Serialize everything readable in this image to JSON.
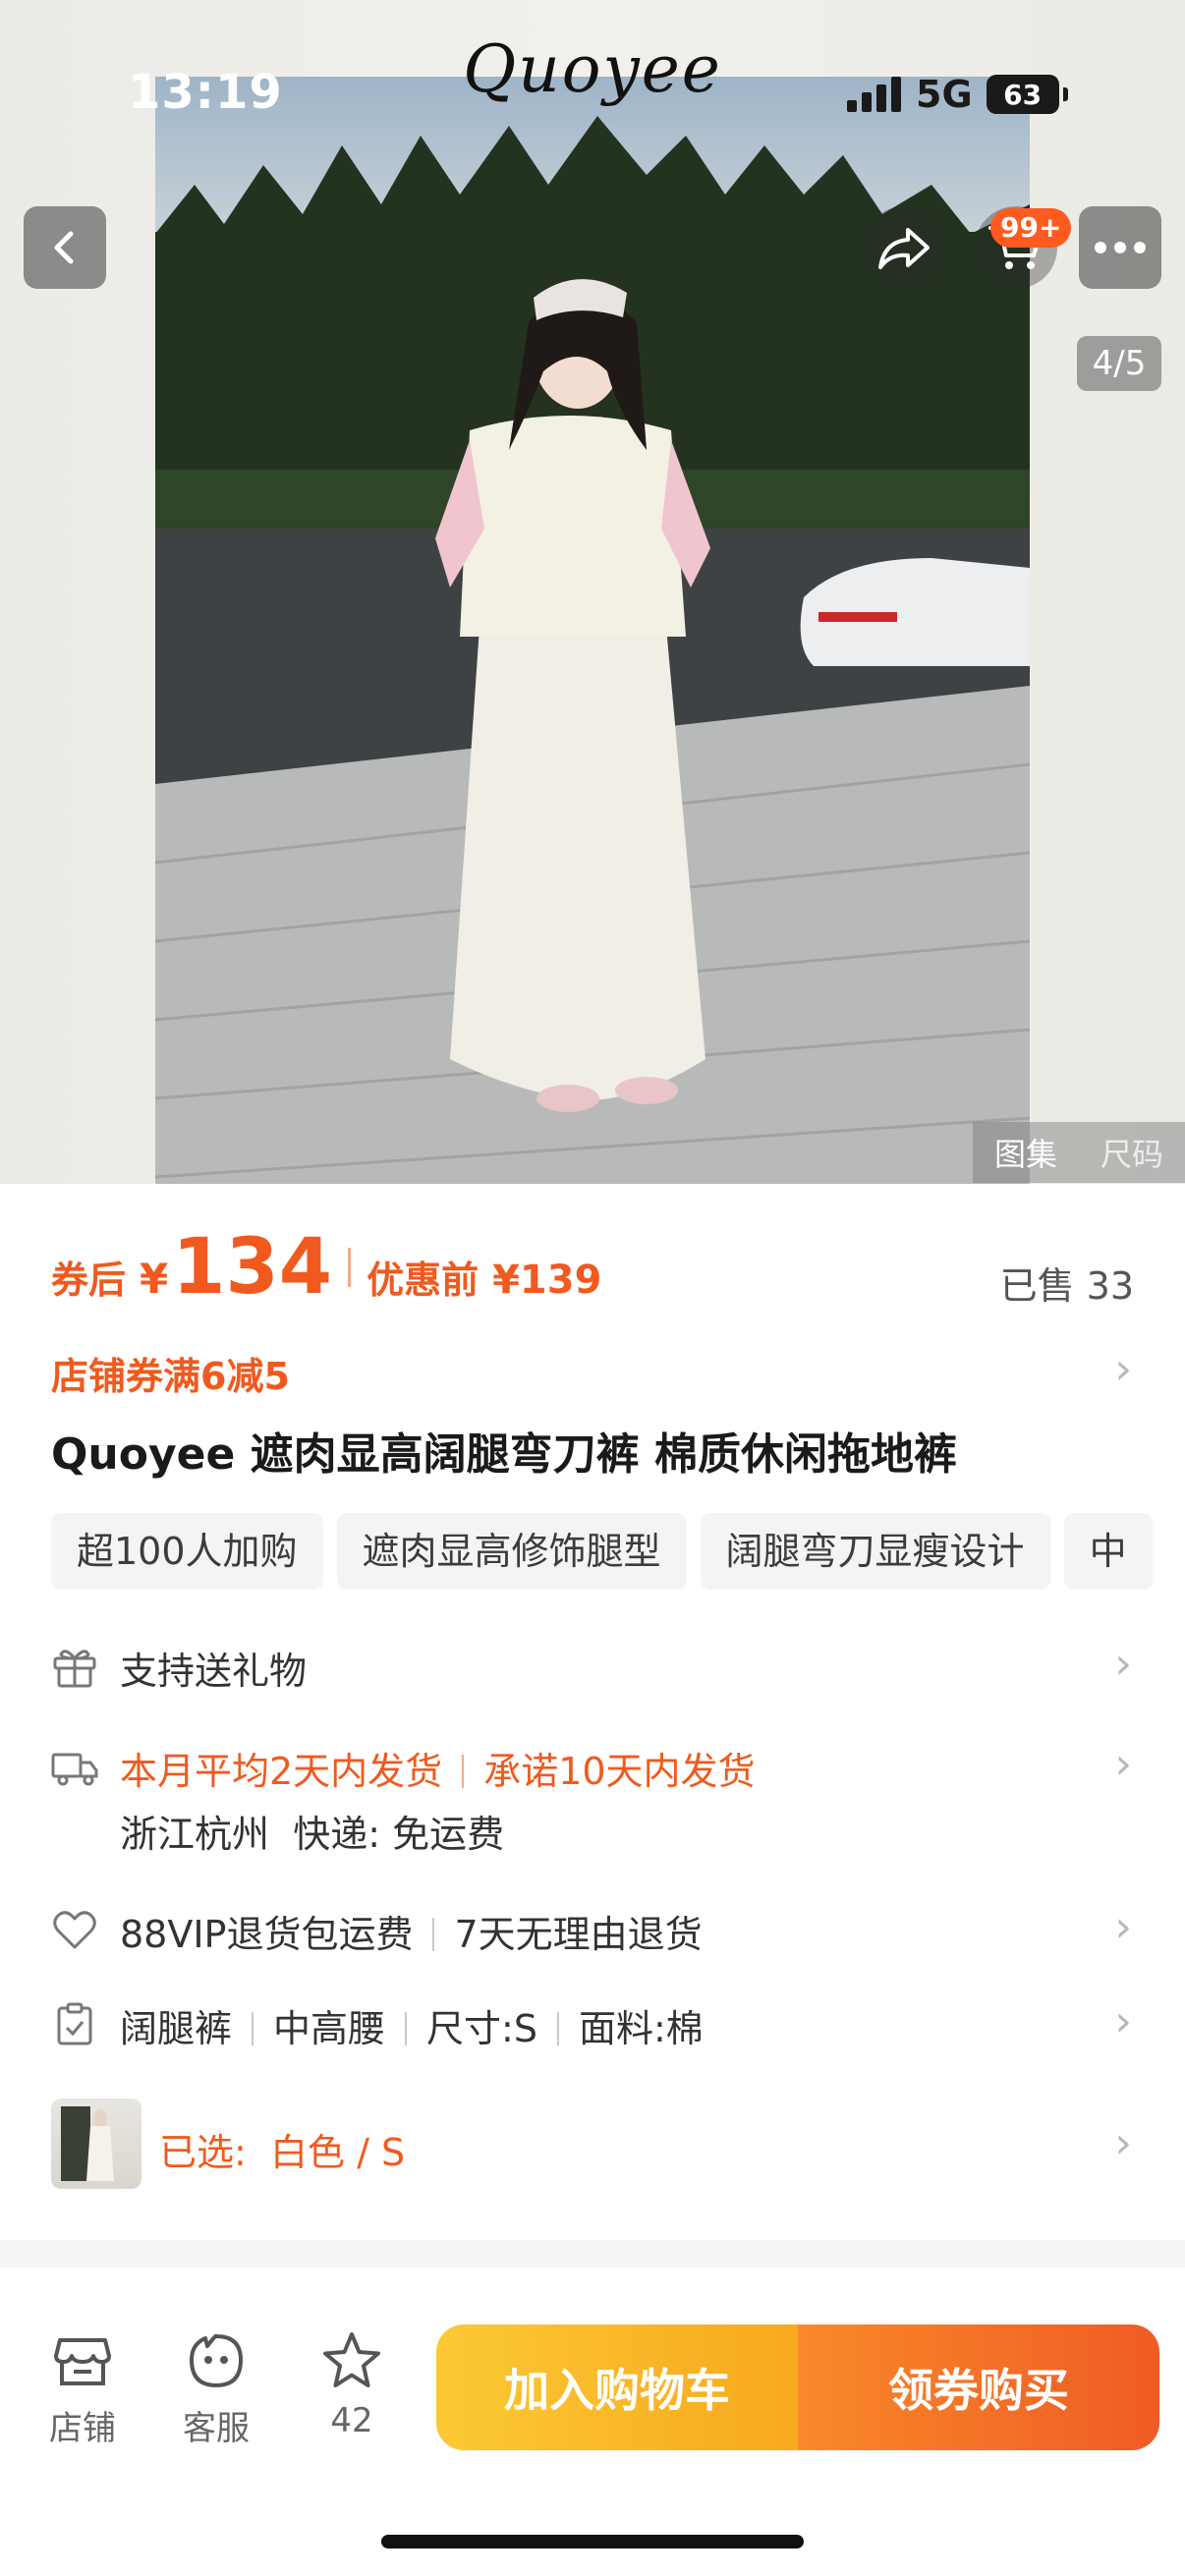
{
  "status": {
    "time": "13:19",
    "network": "5G",
    "battery": "63"
  },
  "brand": {
    "name": "Quoyee"
  },
  "header": {
    "cart_badge": "99+",
    "pager": "4/5"
  },
  "gallery": {
    "tabs": [
      "图集",
      "尺码"
    ]
  },
  "price": {
    "after_label": "券后",
    "currency": "¥",
    "after_value": "134",
    "before_label": "优惠前",
    "before_value": "¥139",
    "sold": "已售 33"
  },
  "coupon": {
    "text": "店铺券满6减5"
  },
  "product": {
    "title": "Quoyee 遮肉显高阔腿弯刀裤 棉质休闲拖地裤"
  },
  "tags": [
    "超100人加购",
    "遮肉显高修饰腿型",
    "阔腿弯刀显瘦设计",
    "中"
  ],
  "rows": {
    "gift": "支持送礼物",
    "ship_avg": "本月平均2天内发货",
    "ship_promise": "承诺10天内发货",
    "ship_origin": "浙江杭州",
    "ship_fee": "快递: 免运费",
    "vip_return": "88VIP退货包运费",
    "no_reason": "7天无理由退货",
    "attr1": "阔腿裤",
    "attr2": "中高腰",
    "attr3": "尺寸:S",
    "attr4": "面料:棉",
    "selected_label": "已选:",
    "selected_value": "白色 / S"
  },
  "bottom": {
    "store": "店铺",
    "service": "客服",
    "favorites": "42",
    "add_cart": "加入购物车",
    "buy": "领券购买"
  },
  "colors": {
    "accent": "#f05a1e",
    "cart_btn": "#fbc934",
    "buy_btn": "#ef5b24"
  },
  "icons": [
    "back-icon",
    "share-icon",
    "cart-icon",
    "more-icon",
    "gift-icon",
    "truck-icon",
    "heart-icon",
    "clipboard-icon",
    "store-icon",
    "service-icon",
    "star-icon",
    "chevron-right-icon"
  ]
}
